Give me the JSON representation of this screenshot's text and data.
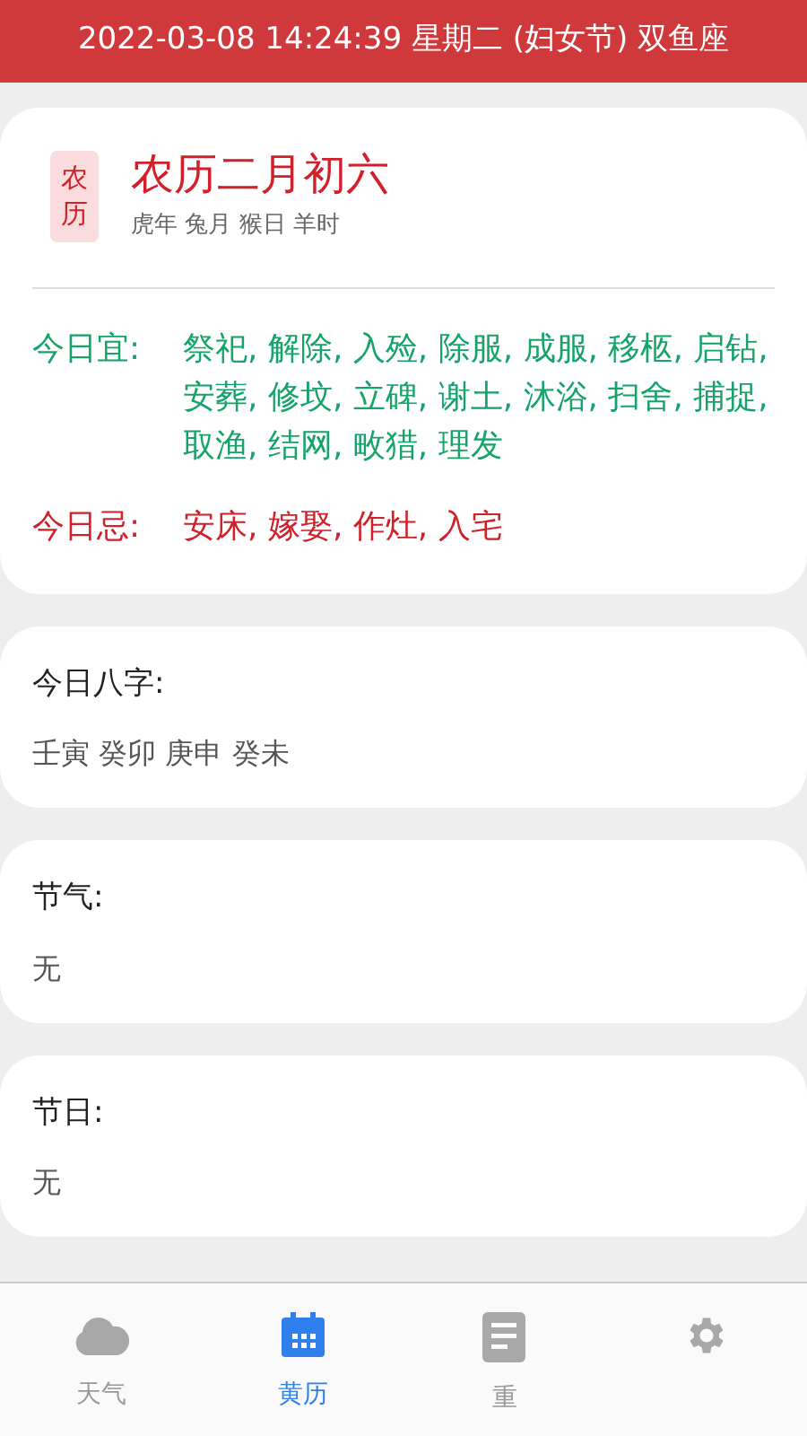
{
  "status_bar": {
    "text": "2022-03-08 14:24:39 星期二 (妇女节) 双鱼座"
  },
  "lunar": {
    "badge": "农历",
    "date": "农历二月初六",
    "ganzhi": "虎年 兔月 猴日 羊时"
  },
  "advice": [
    {
      "kind": "good",
      "label": "今日宜:",
      "text": "祭祀, 解除, 入殓, 除服, 成服, 移柩, 启钻, 安葬, 修坟, 立碑, 谢土, 沐浴, 扫舍, 捕捉, 取渔, 结网, 畋猎, 理发"
    },
    {
      "kind": "bad",
      "label": "今日忌:",
      "text": "安床, 嫁娶, 作灶, 入宅"
    }
  ],
  "sections": [
    {
      "title": "今日八字:",
      "value": "壬寅 癸卯 庚申 癸未"
    },
    {
      "title": "节气:",
      "value": "无"
    },
    {
      "title": "节日:",
      "value": "无"
    }
  ],
  "nav": [
    {
      "kind": "cloud",
      "label": "天气",
      "selected": false
    },
    {
      "kind": "calendar",
      "label": "黄历",
      "selected": true
    },
    {
      "kind": "document",
      "label": "重",
      "selected": false
    },
    {
      "kind": "gear",
      "selected": false
    }
  ]
}
